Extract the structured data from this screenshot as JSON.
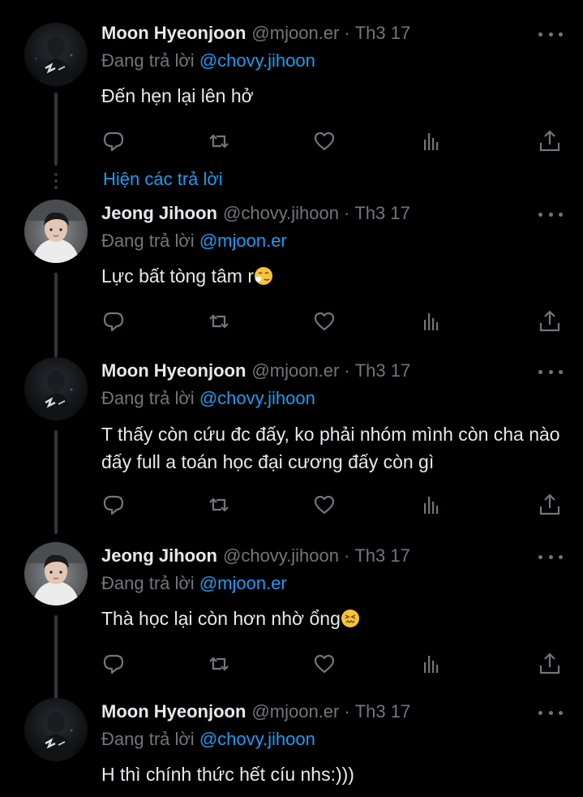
{
  "colors": {
    "background": "#000000",
    "text": "#e7e9ea",
    "secondary": "#71767b",
    "accent": "#1d9bf0",
    "thread_line": "#333639"
  },
  "labels": {
    "replying_to": "Đang trả lời",
    "date_separator": "·",
    "show_replies": "Hiện các trả lời"
  },
  "tweets": [
    {
      "name": "Moon Hyeonjoon",
      "handle": "@mjoon.er",
      "date": "Th3 17",
      "reply_to": "@chovy.jihoon",
      "text": "Đến hẹn lại lên hở",
      "emoji": "",
      "avatar": "avatar-moon"
    },
    {
      "name": "Jeong Jihoon",
      "handle": "@chovy.jihoon",
      "date": "Th3 17",
      "reply_to": "@mjoon.er",
      "text": "Lực bất tòng tâm r",
      "emoji": "sneezing-face-emoji",
      "avatar": "avatar-jihoon"
    },
    {
      "name": "Moon Hyeonjoon",
      "handle": "@mjoon.er",
      "date": "Th3 17",
      "reply_to": "@chovy.jihoon",
      "text": "T thấy còn cứu đc đấy, ko phải nhóm mình còn cha nào đấy full a toán học đại cương đấy còn gì",
      "emoji": "",
      "avatar": "avatar-moon"
    },
    {
      "name": "Jeong Jihoon",
      "handle": "@chovy.jihoon",
      "date": "Th3 17",
      "reply_to": "@mjoon.er",
      "text": "Thà học lại còn hơn nhờ ổng",
      "emoji": "confounded-face-emoji",
      "avatar": "avatar-jihoon"
    },
    {
      "name": "Moon Hyeonjoon",
      "handle": "@mjoon.er",
      "date": "Th3 17",
      "reply_to": "@chovy.jihoon",
      "text": "H thì chính thức hết cíu nhs:)))",
      "emoji": "",
      "avatar": "avatar-moon"
    }
  ],
  "action_icons": [
    "reply-icon",
    "retweet-icon",
    "like-icon",
    "views-icon",
    "share-icon"
  ],
  "more_icon": "more-options-icon"
}
